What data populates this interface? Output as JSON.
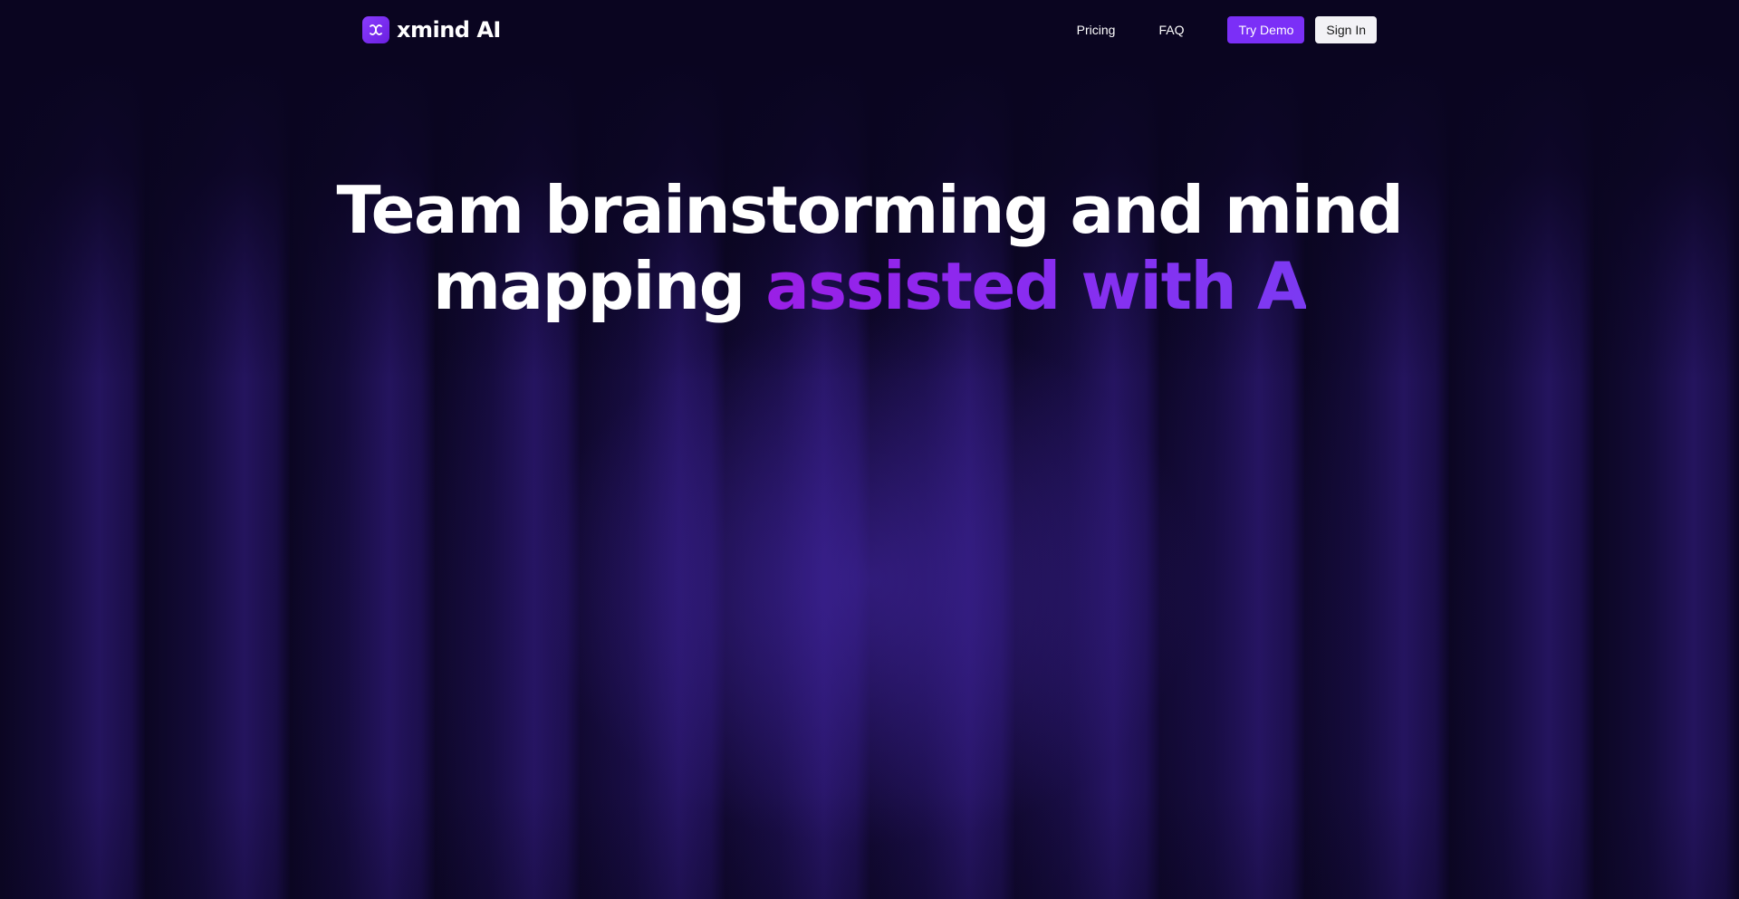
{
  "header": {
    "brand_name": "xmind AI",
    "nav": {
      "pricing": "Pricing",
      "faq": "FAQ"
    },
    "try_demo_label": "Try Demo",
    "sign_in_label": "Sign In"
  },
  "hero": {
    "title_line1": "Team brainstorming and mind",
    "title_line2_plain": "mapping ",
    "title_line2_accent": "assisted with A"
  },
  "colors": {
    "background": "#0a0520",
    "accent": "#7b2ff7",
    "accent_gradient_start": "#9a1fe6",
    "accent_gradient_end": "#7c3af2",
    "sign_in_bg": "#f3f2f6"
  },
  "icons": {
    "logo": "xmind-logo-icon"
  }
}
